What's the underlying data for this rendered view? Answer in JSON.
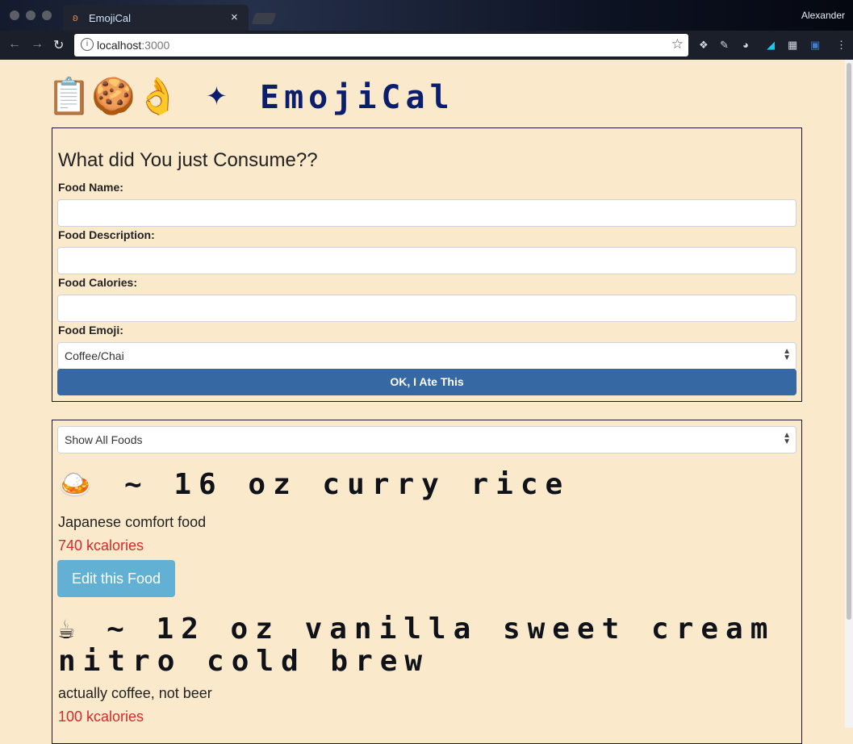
{
  "browser": {
    "tab_title": "EmojiCal",
    "tab_close": "×",
    "user": "Alexander",
    "url_host": "localhost",
    "url_port": ":3000",
    "star": "☆",
    "back": "←",
    "forward": "→",
    "reload": "↻"
  },
  "header": {
    "emojis": [
      "📋",
      "🍪",
      "👌"
    ],
    "sparkle": "✦",
    "brand": "EmojiCal"
  },
  "form": {
    "title": "What did You just Consume??",
    "name_label": "Food Name:",
    "desc_label": "Food Description:",
    "cal_label": "Food Calories:",
    "emoji_label": "Food Emoji:",
    "emoji_selected": "Coffee/Chai",
    "submit_label": "OK, I Ate This"
  },
  "list": {
    "filter_selected": "Show All Foods",
    "foods": [
      {
        "emoji": "🍛",
        "title": "~ 16 oz curry rice",
        "description": "Japanese comfort food",
        "calories": "740 kcalories",
        "edit_label": "Edit this Food"
      },
      {
        "emoji": "☕",
        "title": "~ 12 oz vanilla sweet cream nitro cold brew",
        "description": "actually coffee, not beer",
        "calories": "100 kcalories"
      }
    ]
  },
  "colors": {
    "page_bg": "#fbe9cc",
    "brand": "#0b1e6e",
    "submit": "#3668a3",
    "edit": "#62b0d3",
    "calories": "#d12b2b"
  }
}
